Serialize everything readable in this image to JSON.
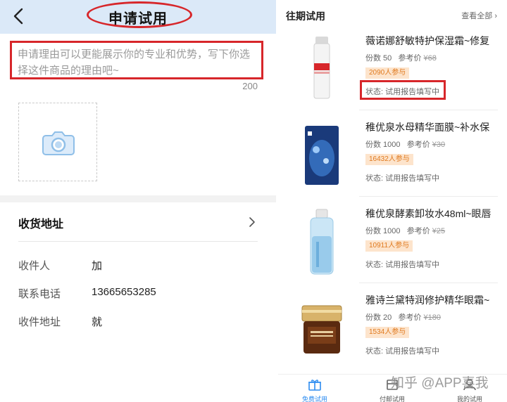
{
  "left_panel": {
    "header": {
      "title": "申请试用",
      "back_icon": "chevron-left-icon"
    },
    "reason": {
      "placeholder": "申请理由可以更能展示你的专业和优势，写下你选择这件商品的理由吧~",
      "char_limit": "200"
    },
    "photo_upload": {
      "icon": "camera-icon"
    },
    "address": {
      "section_title": "收货地址",
      "chevron_icon": "chevron-right-icon",
      "fields": [
        {
          "label": "收件人",
          "value": "加"
        },
        {
          "label": "联系电话",
          "value": "13665653285"
        },
        {
          "label": "收件地址",
          "value": "就"
        }
      ]
    }
  },
  "right_panel": {
    "section_title": "往期试用",
    "view_all": "查看全部",
    "products": [
      {
        "name": "薇诺娜舒敏特护保湿霜~修复",
        "quantity": "份数 50",
        "ref_price_label": "参考价",
        "ref_price": "¥68",
        "participants": "2090人参与",
        "status": "状态: 试用报告填写中"
      },
      {
        "name": "稚优泉水母精华面膜~补水保",
        "quantity": "份数 1000",
        "ref_price_label": "参考价",
        "ref_price": "¥30",
        "participants": "16432人参与",
        "status": "状态: 试用报告填写中"
      },
      {
        "name": "稚优泉酵素卸妆水48ml~眼唇",
        "quantity": "份数 1000",
        "ref_price_label": "参考价",
        "ref_price": "¥25",
        "participants": "10911人参与",
        "status": "状态: 试用报告填写中"
      },
      {
        "name": "雅诗兰黛特润修护精华眼霜~",
        "quantity": "份数 20",
        "ref_price_label": "参考价",
        "ref_price": "¥180",
        "participants": "1534人参与",
        "status": "状态: 试用报告填写中"
      }
    ],
    "tabbar": [
      {
        "label": "免费试用",
        "icon": "gift-icon",
        "active": true
      },
      {
        "label": "付邮试用",
        "icon": "package-icon",
        "active": false
      },
      {
        "label": "我的试用",
        "icon": "user-icon",
        "active": false
      }
    ]
  },
  "watermark": "知乎 @APP喜我",
  "colors": {
    "accent_blue": "#2d8cf0",
    "highlight_red": "#d7262a",
    "badge_bg": "#fde4cc",
    "badge_text": "#e07a1f",
    "header_bg": "#dbe9f8"
  }
}
